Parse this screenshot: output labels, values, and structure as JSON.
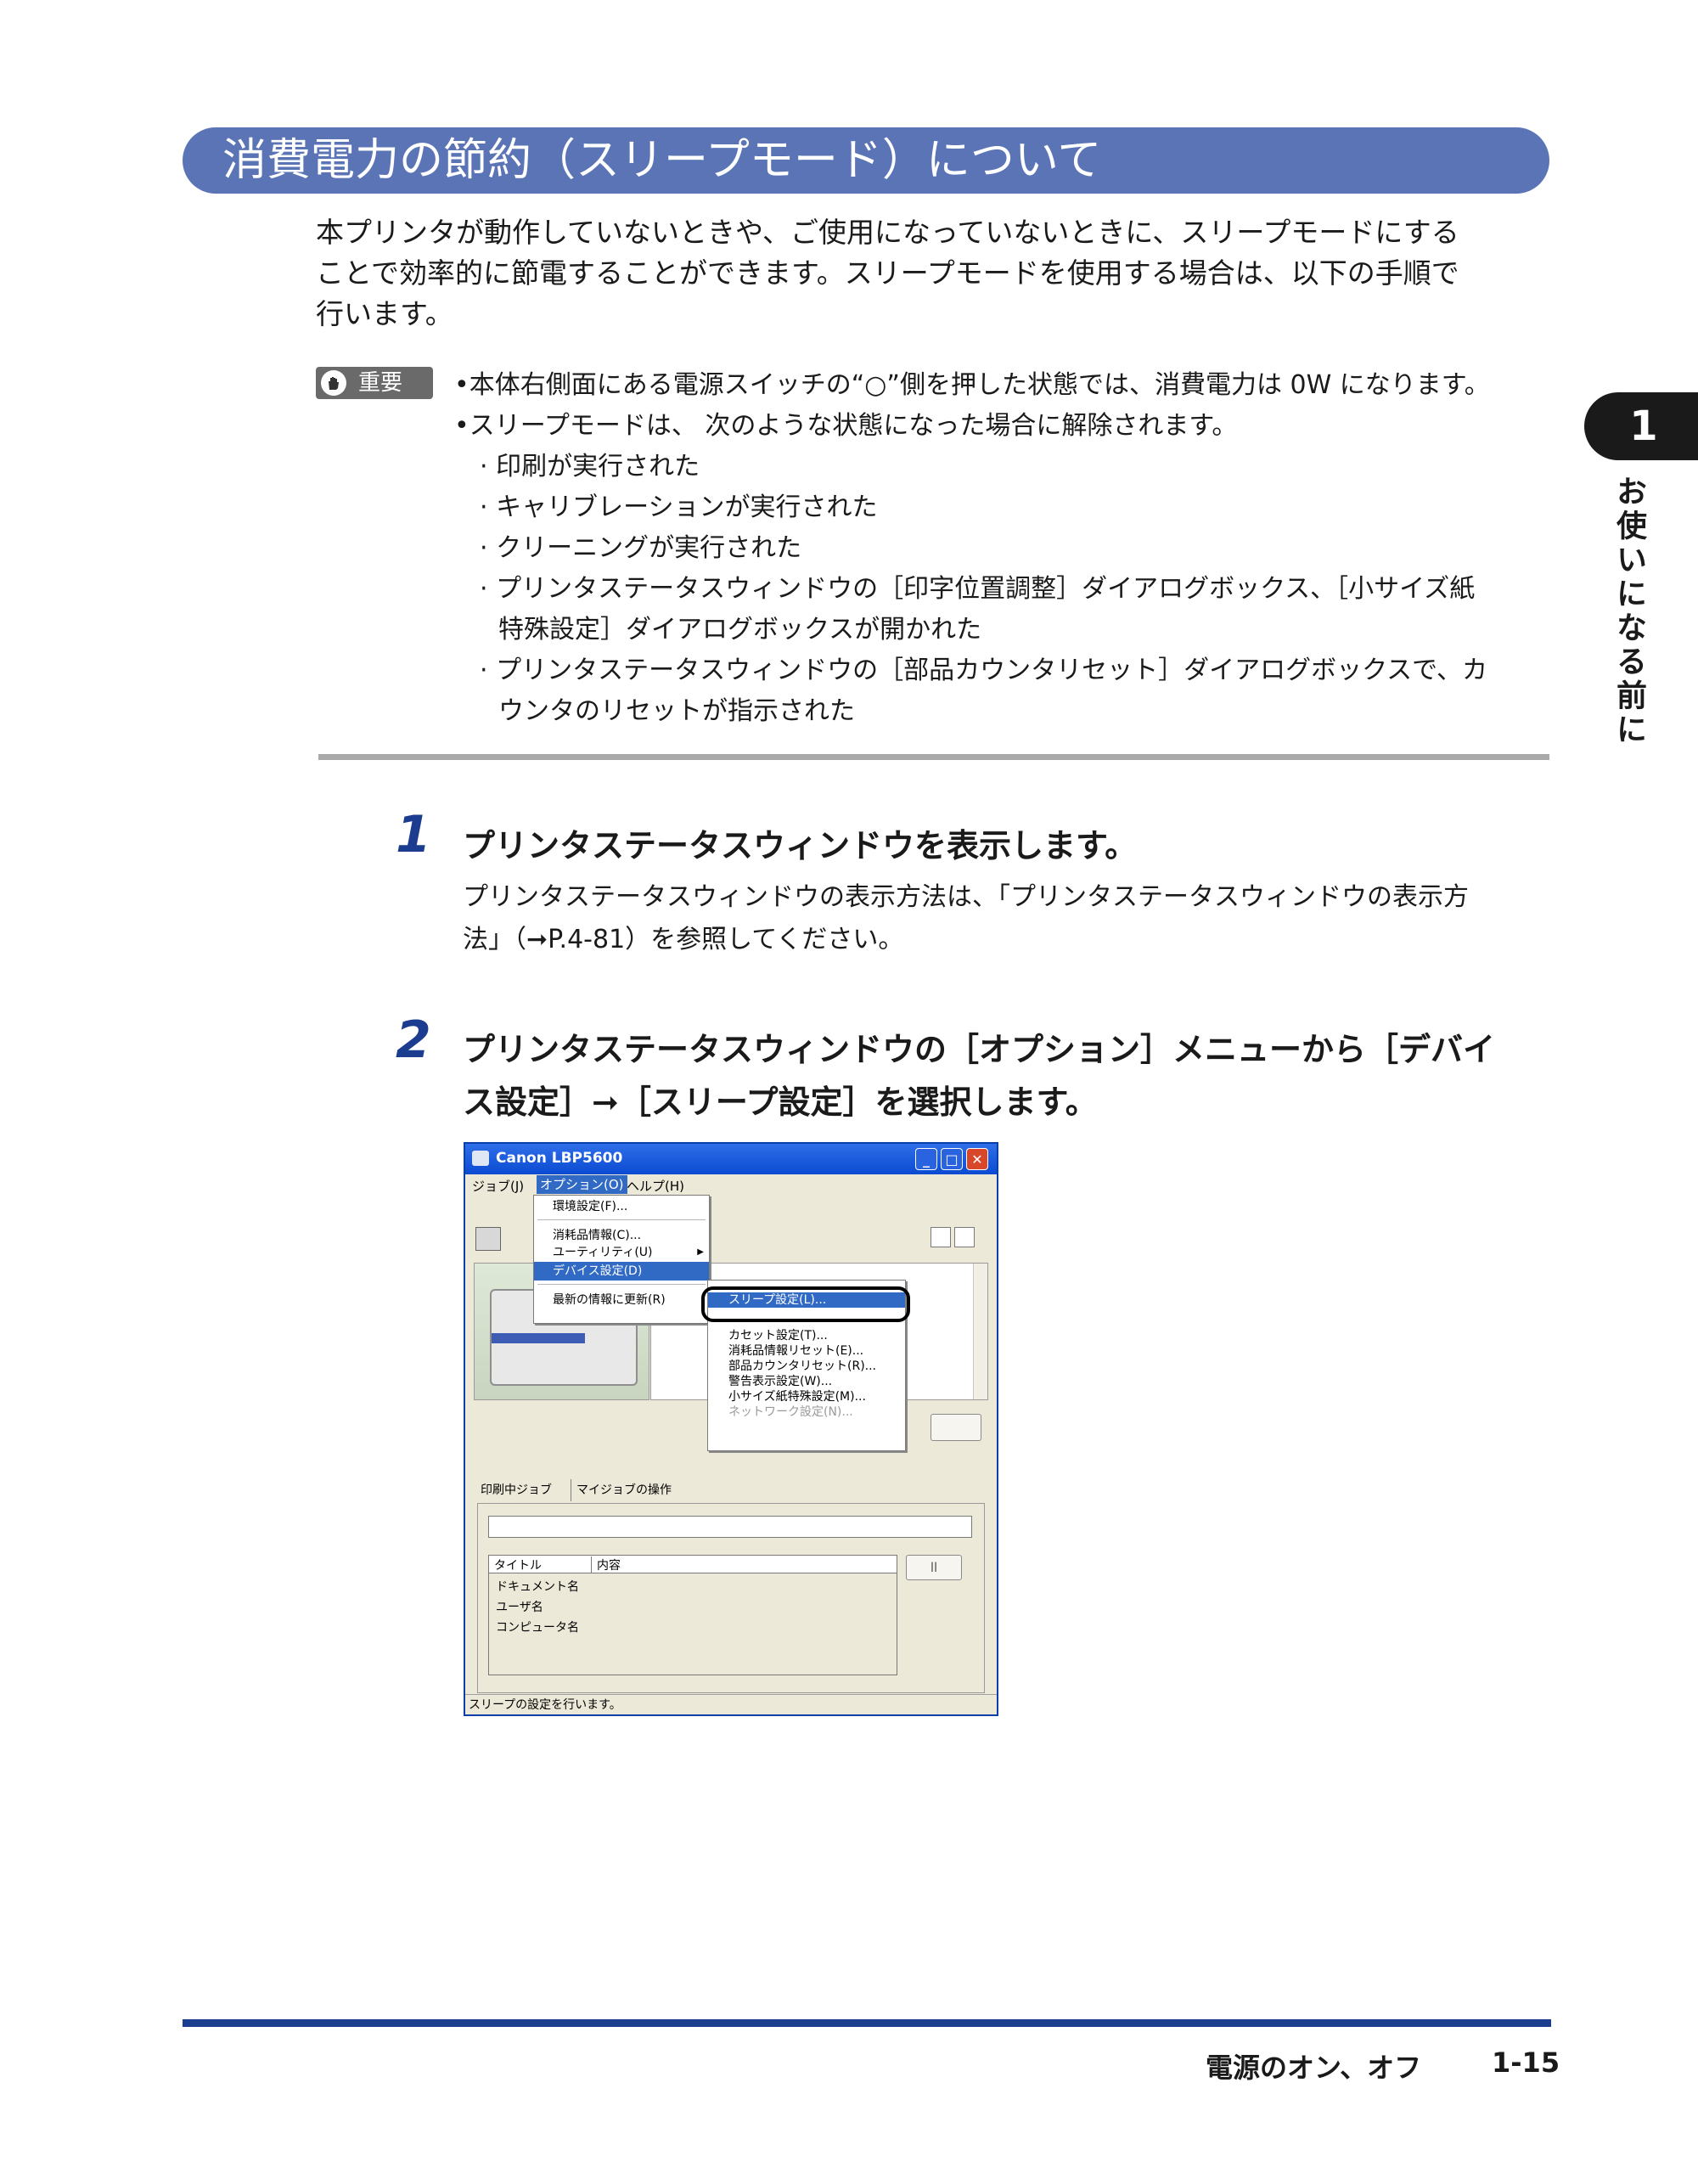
{
  "section": {
    "title": "消費電力の節約（スリープモード）について"
  },
  "intro": {
    "lines": [
      "本プリンタが動作していないときや、ご使用になっていないときに、スリープモードにする",
      "ことで効率的に節電することができます。スリープモードを使用する場合は、以下の手順で",
      "行います。"
    ]
  },
  "important": {
    "badge": "重要",
    "bullet1": "•本体右側面にある電源スイッチの“○”側を押した状態では、消費電力は 0W になります。",
    "bullet2": "•スリープモードは、 次のような状態になった場合に解除されます。",
    "items": [
      "· 印刷が実行された",
      "· キャリブレーションが実行された",
      "· クリーニングが実行された",
      "· プリンタステータスウィンドウの［印字位置調整］ダイアログボックス、［小サイズ紙",
      "特殊設定］ダイアログボックスが開かれた",
      "· プリンタステータスウィンドウの［部品カウンタリセット］ダイアログボックスで、カ",
      "ウンタのリセットが指示された"
    ]
  },
  "step1": {
    "number": "1",
    "title": "プリンタステータスウィンドウを表示します。",
    "body": [
      "プリンタステータスウィンドウの表示方法は、「プリンタステータスウィンドウの表示方",
      "法」（➞P.4-81）を参照してください。"
    ]
  },
  "step2": {
    "number": "2",
    "title": [
      "プリンタステータスウィンドウの［オプション］メニューから［デバイ",
      "ス設定］➞［スリープ設定］を選択します。"
    ]
  },
  "screenshot": {
    "window_title": "Canon LBP5600",
    "menubar": {
      "job": "ジョブ(J)",
      "options": "オプション(O)",
      "help": "ヘルプ(H)"
    },
    "options_menu": {
      "env": "環境設定(F)...",
      "consumables": "消耗品情報(C)...",
      "utility": "ユーティリティ(U)",
      "device": "デバイス設定(D)",
      "refresh": "最新の情報に更新(R)"
    },
    "device_submenu": {
      "sleep": "スリープ設定(L)...",
      "cassette": "カセット設定(T)...",
      "consumables_reset": "消耗品情報リセット(E)...",
      "parts_reset": "部品カウンタリセット(R)...",
      "warning": "警告表示設定(W)...",
      "small_paper": "小サイズ紙特殊設定(M)...",
      "network": "ネットワーク設定(N)..."
    },
    "tabs": {
      "printing": "印刷中ジョブ",
      "myjob": "マイジョブの操作"
    },
    "table": {
      "col_title": "タイトル",
      "col_content": "内容",
      "rows": [
        "ドキュメント名",
        "ユーザ名",
        "コンピュータ名"
      ]
    },
    "pause_glyph": "ll",
    "statusbar": "スリープの設定を行います。"
  },
  "chapter": {
    "number": "1",
    "title": "お使いになる前に"
  },
  "footer": {
    "section": "電源のオン、オフ",
    "page": "1-15"
  },
  "colors": {
    "band": "#5a74b6",
    "step_number": "#1b3c8f",
    "footer_rule": "#1b3c8f"
  }
}
